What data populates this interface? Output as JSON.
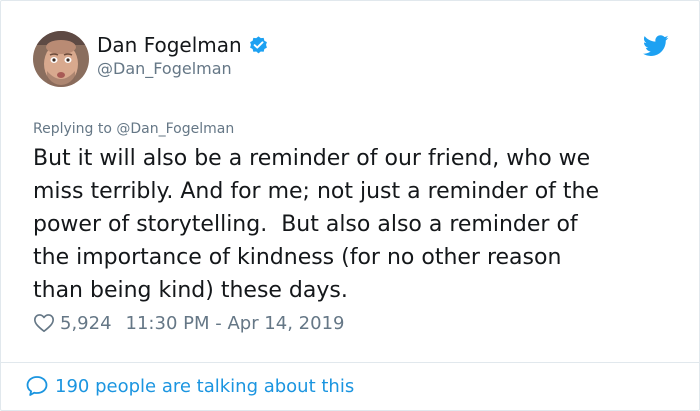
{
  "colors": {
    "accent": "#1da1f2",
    "link": "#1b95e0",
    "muted": "#657786",
    "text": "#14171a",
    "border": "#e1e8ed"
  },
  "author": {
    "name": "Dan Fogelman",
    "handle": "@Dan_Fogelman",
    "verified_icon": "verified-badge-icon",
    "avatar": "avatar"
  },
  "brand_icon": "twitter-bird-icon",
  "tweet": {
    "replying_to": "Replying to @Dan_Fogelman",
    "text": "But it will also be a reminder of our friend, who we\nmiss terribly. And for me; not just a reminder of the\npower of storytelling.  But also also a reminder of\nthe importance of kindness (for no other reason\nthan being kind) these days.",
    "likes": "5,924",
    "timestamp": "11:30 PM - Apr 14, 2019",
    "like_icon": "heart-icon"
  },
  "footer": {
    "talking_label": "190 people are talking about this",
    "talking_icon": "speech-bubble-icon"
  }
}
